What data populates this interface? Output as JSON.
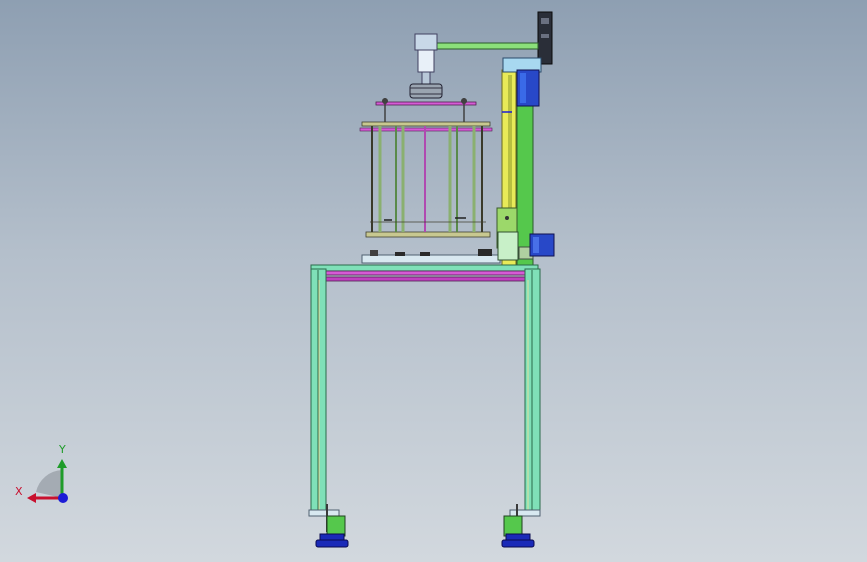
{
  "viewport": {
    "background_top": "#8e9fb2",
    "background_bottom": "#d2d8de"
  },
  "triad": {
    "x_label": "X",
    "y_label": "Y",
    "x_color": "#c8102e",
    "y_color": "#1f9c2a",
    "z_color": "#1c1cd6"
  },
  "model_colors": {
    "frame_cyan": "#7fe0b8",
    "frame_outline": "#2a6a4a",
    "magenta_rail": "#d65ad6",
    "column_yellow": "#e8ea58",
    "column_green": "#55c84c",
    "motor_blue": "#2848c8",
    "foot_blue": "#1a2ab8",
    "cage_tan": "#c8c890"
  }
}
